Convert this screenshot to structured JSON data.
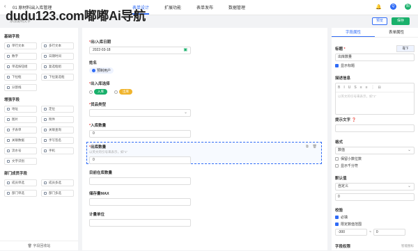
{
  "header": {
    "back_arrow": "‹",
    "title": "01 原材料出入库管理",
    "watermark": "dudu123.com嘟嘟Ai导航",
    "tabs": [
      {
        "label": "表单设计",
        "active": true
      },
      {
        "label": "扩展功能",
        "active": false
      },
      {
        "label": "表单发布",
        "active": false
      },
      {
        "label": "数据管理",
        "active": false
      }
    ],
    "avatar1": "Q",
    "avatar2": "阳",
    "preview_label": "预览",
    "save_label": "保存"
  },
  "subbar": {
    "hint": "添加说明文字"
  },
  "left": {
    "groups": [
      {
        "title": "基础字段",
        "items": [
          "单行文本",
          "多行文本",
          "数字",
          "日期时间",
          "单选按钮组",
          "复选框组",
          "下拉框",
          "下拉复选框",
          "分割线"
        ]
      },
      {
        "title": "增强字段",
        "items": [
          "地址",
          "定位",
          "图片",
          "附件",
          "子表单",
          "关联查询",
          "关联数据",
          "手写签名",
          "流水号",
          "手机",
          "文字识别"
        ]
      },
      {
        "title": "部门成员字段",
        "items": [
          "成员单选",
          "成员多选",
          "部门单选",
          "部门多选"
        ]
      }
    ],
    "footer": "字段回收站"
  },
  "canvas": {
    "date_field": {
      "label": "出/入库日期",
      "required": "*",
      "value": "2022-03-18"
    },
    "name_field": {
      "label": "姓名",
      "value": "预制用户"
    },
    "inout_field": {
      "label": "出入库选择",
      "required": "*",
      "options": [
        {
          "label": "入库",
          "color": "#19b06b"
        },
        {
          "label": "出库",
          "color": "#f0b42d"
        }
      ]
    },
    "type_field": {
      "label": "货品类型",
      "required": "*",
      "caret": "⌄"
    },
    "inqty_field": {
      "label": "入库数量",
      "required": "*",
      "value": "0"
    },
    "outqty_field": {
      "label": "出库数量",
      "required": "*",
      "hint": "以英文的引号来表示，如“1”",
      "value": "0"
    },
    "stock_field": {
      "label": "目前在库数量"
    },
    "max_field": {
      "label": "储存量MAX"
    },
    "unit_field": {
      "label": "计量单位"
    },
    "sel_icons": [
      "⧉",
      "🗑"
    ]
  },
  "right": {
    "tabs": [
      {
        "label": "字段属性",
        "active": true
      },
      {
        "label": "表单属性",
        "active": false
      }
    ],
    "title_label": "标题",
    "title_value": "出库数量",
    "align_label": "靠下",
    "show_title": "显示标题",
    "desc_label": "描述信息",
    "editor_tools": [
      "B",
      "I",
      "U",
      "S",
      "≡",
      "≡",
      "⋮",
      "⊟"
    ],
    "desc_placeholder": "以英文的引号来表示，如“1”",
    "hint_label": "提示文字",
    "format_label": "格式",
    "format_value": "数值",
    "caret": "⌄",
    "chk_decimal": "保留小数位数",
    "chk_thousand": "显示千分符",
    "default_label": "默认值",
    "default_value": "自定义",
    "default_num": "0",
    "validate_label": "校验",
    "chk_required": "必填",
    "chk_range": "限定数值范围",
    "range_min": "-300",
    "range_sep": "~",
    "range_max": "0",
    "perm_label": "字段权限",
    "brand": "智能图标"
  }
}
